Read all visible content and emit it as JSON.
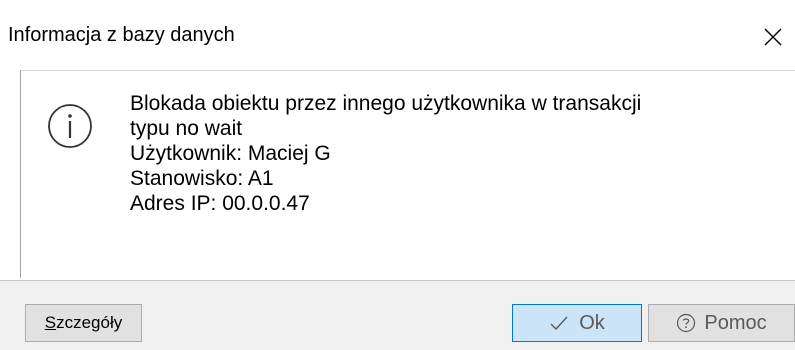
{
  "dialog": {
    "title": "Informacja z bazy danych",
    "close_icon": "close-icon"
  },
  "message": {
    "icon": "info-icon",
    "lines": [
      "Blokada obiektu przez innego użytkownika w transakcji",
      "typu no wait",
      "Użytkownik: Maciej G",
      "Stanowisko: A1",
      "Adres IP: 00.0.0.47"
    ]
  },
  "buttons": {
    "details_mnemonic": "S",
    "details_rest": "zczegóły",
    "ok_label": "Ok",
    "ok_icon": "checkmark-icon",
    "help_label": "Pomoc",
    "help_icon": "question-circle-icon"
  },
  "colors": {
    "footer_bg": "#f0f0f0",
    "ok_button_bg": "#cce4f7",
    "ok_button_border": "#0078d7"
  }
}
